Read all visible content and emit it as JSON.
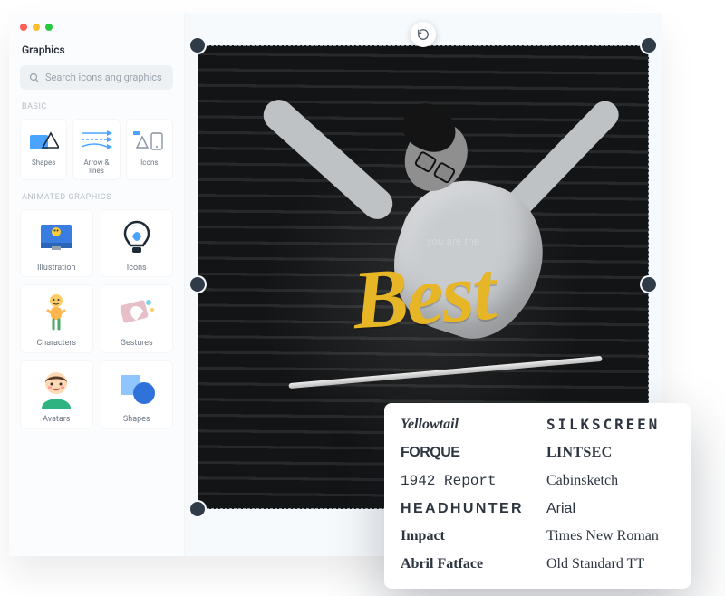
{
  "sidebar": {
    "title": "Graphics",
    "search_placeholder": "Search icons ang graphics",
    "basic_label": "BASIC",
    "animated_label": "ANIMATED GRAPHICS",
    "basic": [
      {
        "label": "Shapes"
      },
      {
        "label": "Arrow & lines"
      },
      {
        "label": "Icons"
      }
    ],
    "animated": [
      {
        "label": "Illustration"
      },
      {
        "label": "Icons"
      },
      {
        "label": "Characters"
      },
      {
        "label": "Gestures"
      },
      {
        "label": "Avatars"
      },
      {
        "label": "Shapes"
      }
    ]
  },
  "canvas": {
    "overline": "you are the",
    "headline": "Best"
  },
  "fonts": [
    "Yellowtail",
    "SILKSCREEN",
    "FORQUE",
    "LINTSEC",
    "1942 Report",
    "Cabinsketch",
    "HEADHUNTER",
    "Arial",
    "Impact",
    "Times New Roman",
    "Abril Fatface",
    "Old Standard TT"
  ]
}
